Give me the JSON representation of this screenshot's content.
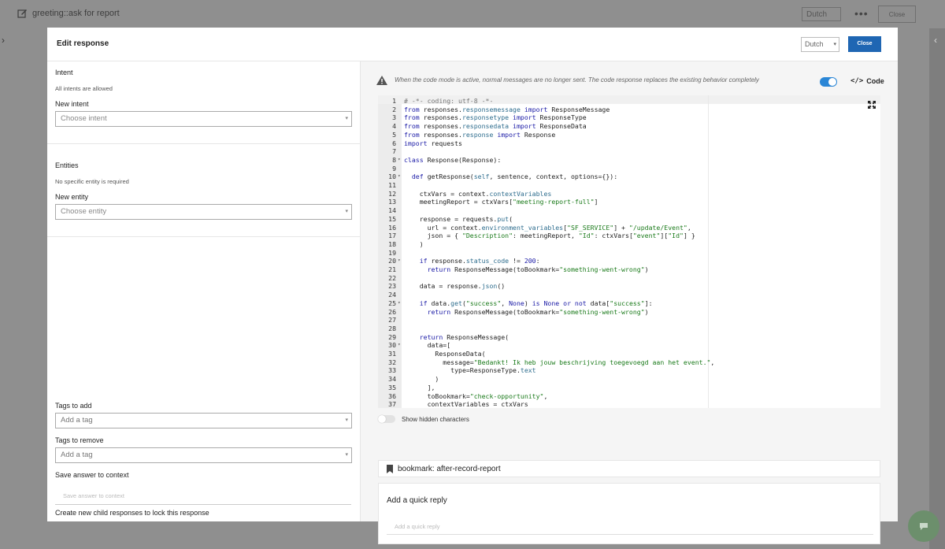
{
  "background": {
    "title": "greeting::ask for report",
    "language": "Dutch",
    "more": "•••",
    "close": "Close"
  },
  "modal": {
    "title": "Edit response",
    "language": "Dutch",
    "close": "Close"
  },
  "left": {
    "intent_label": "Intent",
    "intent_hint": "All intents are allowed",
    "new_intent_label": "New intent",
    "new_intent_placeholder": "Choose intent",
    "entities_label": "Entities",
    "entities_hint": "No specific entity is required",
    "new_entity_label": "New entity",
    "new_entity_placeholder": "Choose entity",
    "tags_add_label": "Tags to add",
    "tags_add_placeholder": "Add a tag",
    "tags_remove_label": "Tags to remove",
    "tags_remove_placeholder": "Add a tag",
    "save_context_label": "Save answer to context",
    "save_context_placeholder": "Save answer to context",
    "child_label": "Create new child responses to lock this response"
  },
  "right": {
    "warning": "When the code mode is active, normal messages are no longer sent. The code response replaces the existing behavior completely",
    "code_label": "Code",
    "code_mode_on": true,
    "show_hidden": "Show hidden characters",
    "bookmark": "bookmark: after-record-report",
    "quick_reply_title": "Add a quick reply",
    "quick_reply_placeholder": "Add a quick reply"
  },
  "code_lines": [
    {
      "n": "1",
      "fold": "",
      "html": "<span class=\"c\"># -*- coding: utf-8 -*-</span>"
    },
    {
      "n": "2",
      "fold": "",
      "html": "<span class=\"k\">from</span> responses.<span class=\"m\">responsemessage</span> <span class=\"k\">import</span> ResponseMessage"
    },
    {
      "n": "3",
      "fold": "",
      "html": "<span class=\"k\">from</span> responses.<span class=\"m\">responsetype</span> <span class=\"k\">import</span> ResponseType"
    },
    {
      "n": "4",
      "fold": "",
      "html": "<span class=\"k\">from</span> responses.<span class=\"m\">responsedata</span> <span class=\"k\">import</span> ResponseData"
    },
    {
      "n": "5",
      "fold": "",
      "html": "<span class=\"k\">from</span> responses.<span class=\"m\">response</span> <span class=\"k\">import</span> Response"
    },
    {
      "n": "6",
      "fold": "",
      "html": "<span class=\"k\">import</span> requests"
    },
    {
      "n": "7",
      "fold": "",
      "html": ""
    },
    {
      "n": "8",
      "fold": "▾",
      "html": "<span class=\"k\">class</span> Response(Response):"
    },
    {
      "n": "9",
      "fold": "",
      "html": ""
    },
    {
      "n": "10",
      "fold": "▾",
      "html": "  <span class=\"k\">def</span> getResponse(<span class=\"m\">self</span>, sentence, context, options={}):"
    },
    {
      "n": "11",
      "fold": "",
      "html": ""
    },
    {
      "n": "12",
      "fold": "",
      "html": "    ctxVars = context.<span class=\"m\">contextVariables</span>"
    },
    {
      "n": "13",
      "fold": "",
      "html": "    meetingReport = ctxVars[<span class=\"s\">\"meeting-report-full\"</span>]"
    },
    {
      "n": "14",
      "fold": "",
      "html": ""
    },
    {
      "n": "15",
      "fold": "",
      "html": "    response = requests.<span class=\"m\">put</span>("
    },
    {
      "n": "16",
      "fold": "",
      "html": "      url = context.<span class=\"m\">environment_variables</span>[<span class=\"s\">\"SF_SERVICE\"</span>] + <span class=\"s\">\"/update/Event\"</span>,"
    },
    {
      "n": "17",
      "fold": "",
      "html": "      json = { <span class=\"s\">\"Description\"</span>: meetingReport, <span class=\"s\">\"Id\"</span>: ctxVars[<span class=\"s\">\"event\"</span>][<span class=\"s\">\"Id\"</span>] }"
    },
    {
      "n": "18",
      "fold": "",
      "html": "    )"
    },
    {
      "n": "19",
      "fold": "",
      "html": ""
    },
    {
      "n": "20",
      "fold": "▾",
      "html": "    <span class=\"k\">if</span> response.<span class=\"m\">status_code</span> != <span class=\"k\">200</span>:"
    },
    {
      "n": "21",
      "fold": "",
      "html": "      <span class=\"k\">return</span> ResponseMessage(toBookmark=<span class=\"s\">\"something-went-wrong\"</span>)"
    },
    {
      "n": "22",
      "fold": "",
      "html": ""
    },
    {
      "n": "23",
      "fold": "",
      "html": "    data = response.<span class=\"m\">json</span>()"
    },
    {
      "n": "24",
      "fold": "",
      "html": ""
    },
    {
      "n": "25",
      "fold": "▾",
      "html": "    <span class=\"k\">if</span> data.<span class=\"m\">get</span>(<span class=\"s\">\"success\"</span>, <span class=\"k\">None</span>) <span class=\"k\">is None or not</span> data[<span class=\"s\">\"success\"</span>]:"
    },
    {
      "n": "26",
      "fold": "",
      "html": "      <span class=\"k\">return</span> ResponseMessage(toBookmark=<span class=\"s\">\"something-went-wrong\"</span>)"
    },
    {
      "n": "27",
      "fold": "",
      "html": ""
    },
    {
      "n": "28",
      "fold": "",
      "html": ""
    },
    {
      "n": "29",
      "fold": "",
      "html": "    <span class=\"k\">return</span> ResponseMessage("
    },
    {
      "n": "30",
      "fold": "▾",
      "html": "      data=["
    },
    {
      "n": "31",
      "fold": "",
      "html": "        ResponseData("
    },
    {
      "n": "32",
      "fold": "",
      "html": "          message=<span class=\"s\">\"Bedankt! Ik heb jouw beschrijving toegevoegd aan het event.\"</span>,"
    },
    {
      "n": "33",
      "fold": "",
      "html": "            type=ResponseType.<span class=\"m\">text</span>"
    },
    {
      "n": "34",
      "fold": "",
      "html": "        )"
    },
    {
      "n": "35",
      "fold": "",
      "html": "      ],"
    },
    {
      "n": "36",
      "fold": "",
      "html": "      toBookmark=<span class=\"s\">\"check-opportunity\"</span>,"
    },
    {
      "n": "37",
      "fold": "",
      "html": "      contextVariables = ctxVars"
    }
  ]
}
